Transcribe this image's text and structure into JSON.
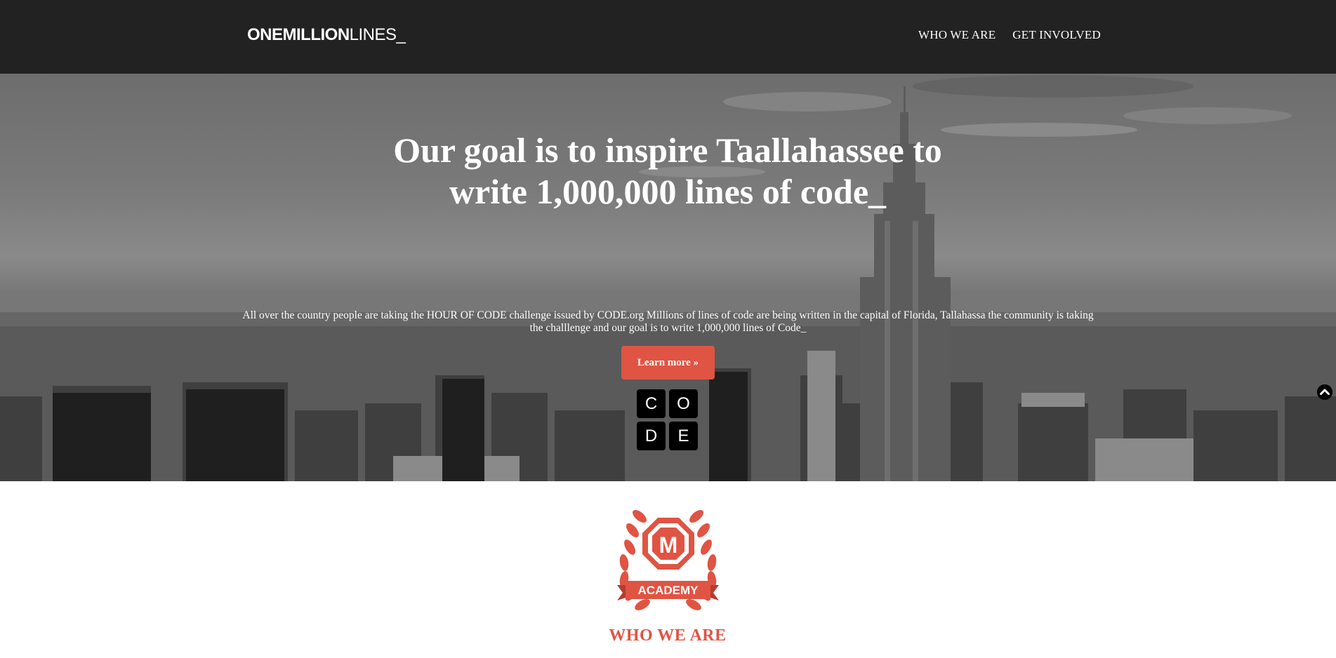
{
  "header": {
    "brand_strong": "ONEMILLION",
    "brand_light": "LINES_",
    "nav": [
      {
        "label": "WHO WE ARE"
      },
      {
        "label": "GET INVOLVED"
      }
    ]
  },
  "hero": {
    "title": "Our goal is to inspire Taallahassee to write 1,000,000 lines of code_",
    "text": "All over the country people are taking the HOUR OF CODE challenge issued by CODE.org Millions of lines of code are being written in the capital of Florida, Tallahassa the community is taking the challlenge and our goal is to write 1,000,000 lines of Code_",
    "button_label": "Learn more »",
    "code_letters": [
      "C",
      "O",
      "D",
      "E"
    ],
    "scroll_icon": "chevron-up-circle-icon"
  },
  "about": {
    "badge_letter": "M",
    "badge_text": "ACADEMY",
    "title": "WHO WE ARE"
  },
  "colors": {
    "header_bg": "#222222",
    "accent": "#e05443",
    "white": "#ffffff"
  }
}
